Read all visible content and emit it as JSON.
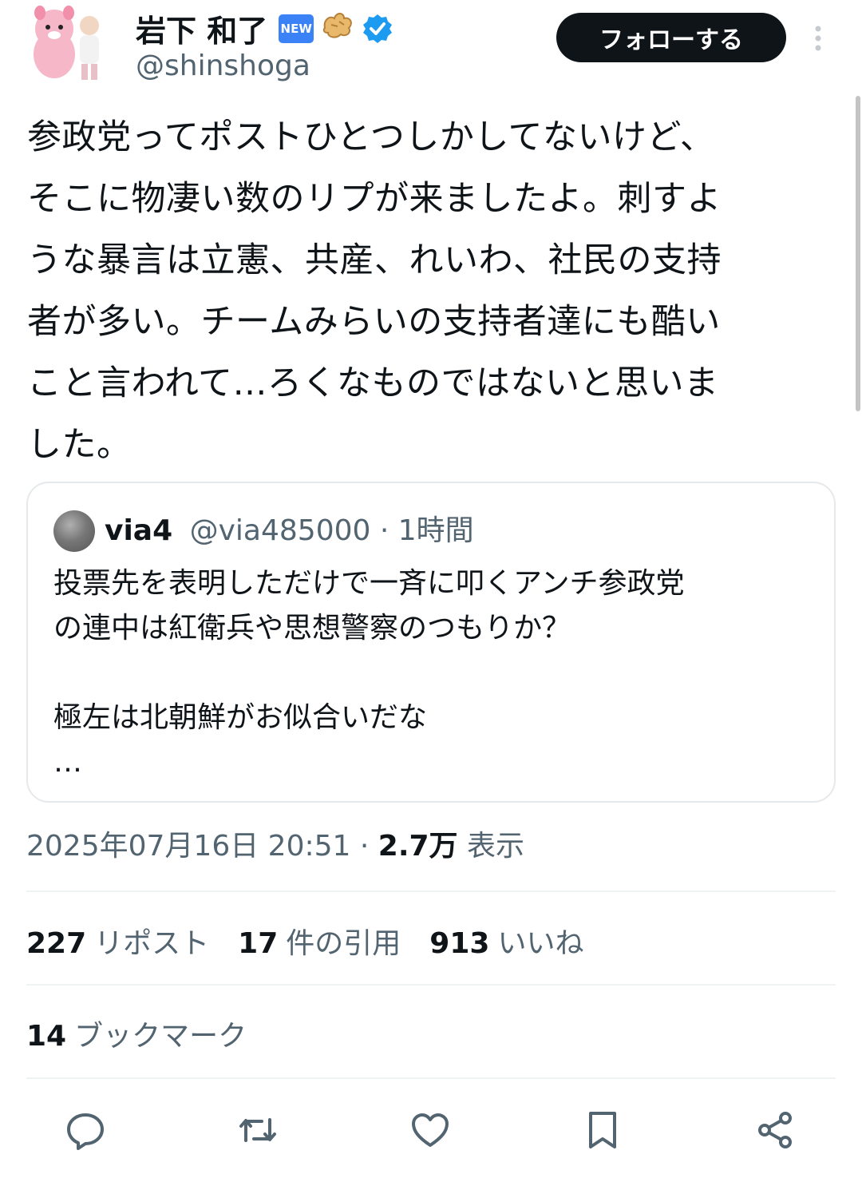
{
  "author": {
    "name": "岩下 和了",
    "new_badge": "NEW",
    "handle": "@shinshoga"
  },
  "follow_label": "フォローする",
  "tweet_text": "参政党ってポストひとつしかしてないけど、\nそこに物凄い数のリプが来ましたよ。刺すよ\nうな暴言は立憲、共産、れいわ、社民の支持\n者が多い。チームみらいの支持者達にも酷い\nこと言われて…ろくなものではないと思いま\nした。",
  "quote": {
    "name": "via4",
    "handle": "@via485000",
    "time": " · 1時間",
    "text": "投票先を表明しただけで一斉に叩くアンチ参政党\nの連中は紅衛兵や思想警察のつもりか？\n\n極左は北朝鮮がお似合いだな\n…"
  },
  "meta": {
    "datetime": "2025年07月16日 20:51 · ",
    "views_count": "2.7万",
    "views_label": " 表示"
  },
  "stats": {
    "reposts_count": "227",
    "reposts_label": "リポスト",
    "quotes_count": "17",
    "quotes_label": "件の引用",
    "likes_count": "913",
    "likes_label": "いいね",
    "bookmarks_count": "14",
    "bookmarks_label": "ブックマーク"
  },
  "icons": [
    "reply-icon",
    "repost-icon",
    "like-icon",
    "bookmark-icon",
    "share-icon"
  ],
  "colors": {
    "text": "#0f1419",
    "secondary": "#536471",
    "follow_bg": "#0f1419",
    "verified": "#1d9bf0"
  }
}
